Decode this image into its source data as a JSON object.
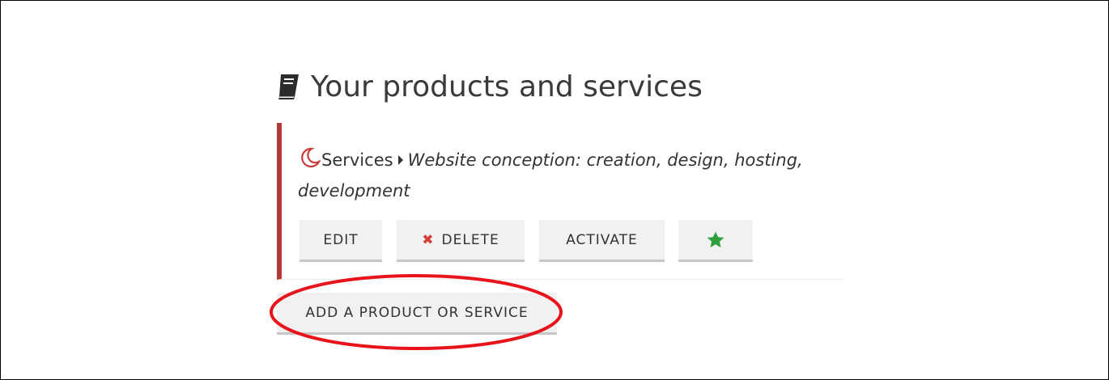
{
  "page": {
    "title": "Your products and services",
    "title_icon": "book-icon"
  },
  "product": {
    "category_icon": "moon-icon",
    "category": "Services",
    "separator_icon": "caret-right-icon",
    "description": "Website conception: creation, design, hosting, development",
    "accent_color": "#b33a3a"
  },
  "actions": {
    "edit_label": "EDIT",
    "delete_icon": "x-icon",
    "delete_label": "DELETE",
    "activate_label": "ACTIVATE",
    "star_icon": "star-icon",
    "star_color": "#2e9e3e"
  },
  "add_button": {
    "label": "ADD A PRODUCT OR SERVICE"
  },
  "annotation": {
    "highlight_color": "#e8141b"
  }
}
